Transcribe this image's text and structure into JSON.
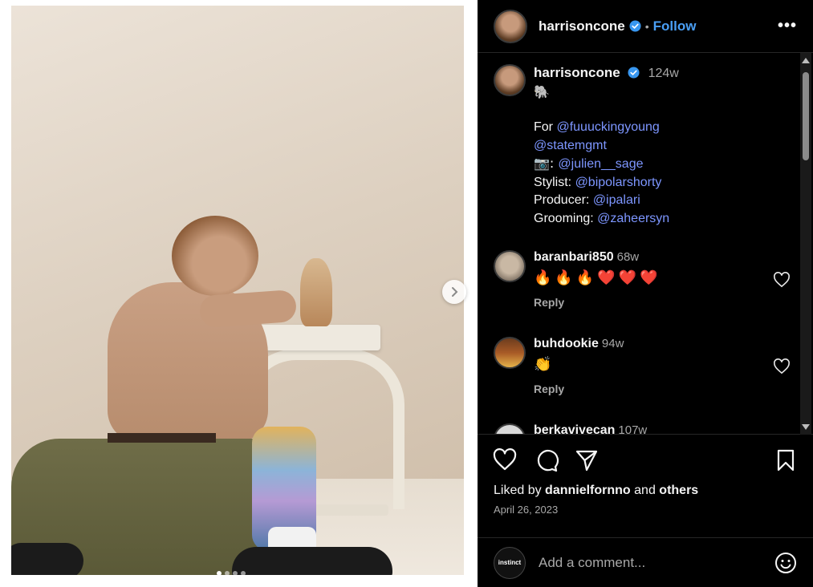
{
  "post": {
    "username": "harrisoncone",
    "follow_label": "Follow",
    "separator": "•",
    "more_label": "•••"
  },
  "caption": {
    "username": "harrisoncone",
    "time": "124w",
    "emoji": "🐘",
    "line1_prefix": "For ",
    "line1_mention": "@fuuuckingyoung",
    "line2_mention": "@statemgmt",
    "line3_prefix": "📷: ",
    "line3_mention": "@julien__sage",
    "line4_prefix": "Stylist: ",
    "line4_mention": "@bipolarshorty",
    "line5_prefix": "Producer: ",
    "line5_mention": "@ipalari",
    "line6_prefix": "Grooming: ",
    "line6_mention": "@zaheersyn"
  },
  "comments": [
    {
      "username": "baranbari850",
      "time": "68w",
      "text": "🔥🔥🔥❤️❤️❤️",
      "reply_label": "Reply"
    },
    {
      "username": "buhdookie",
      "time": "94w",
      "text": "👏",
      "reply_label": "Reply"
    },
    {
      "username": "berkaviyecan",
      "time": "107w"
    }
  ],
  "likes": {
    "prefix": "Liked by ",
    "user": "dannielfornno",
    "middle": " and ",
    "others": "others"
  },
  "date": "April 26, 2023",
  "comment_input": {
    "placeholder": "Add a comment...",
    "avatar_text": "instinct"
  },
  "colors": {
    "accent": "#4a9ff5",
    "mention": "#7d96ff",
    "background": "#000000",
    "muted": "#a8a8a8"
  },
  "carousel": {
    "count": 4,
    "active_index": 0
  }
}
